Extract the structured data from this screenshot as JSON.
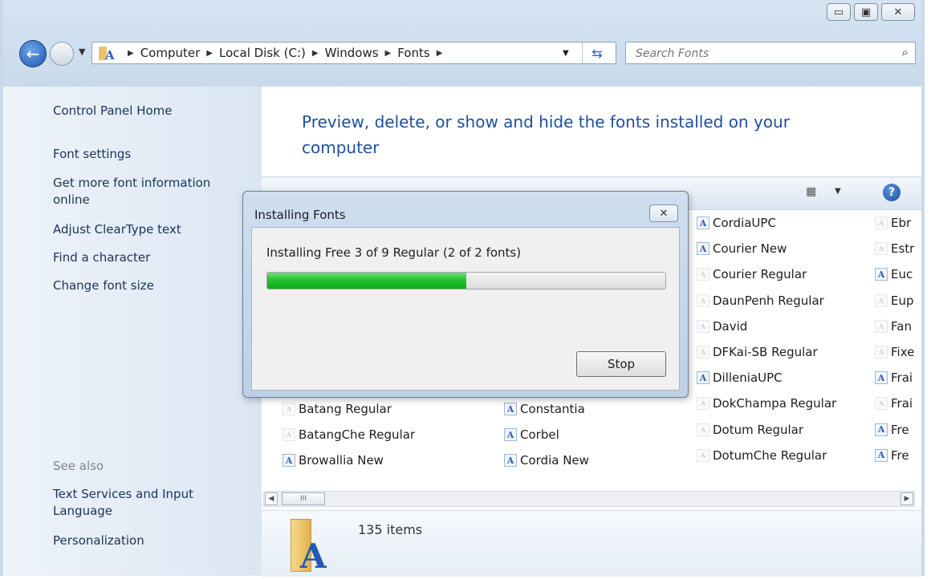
{
  "window": {
    "caption": {
      "minimize": "▭",
      "maximize": "▣",
      "close": "✕"
    }
  },
  "nav": {
    "back_glyph": "←",
    "breadcrumbs": [
      "Computer",
      "Local Disk (C:)",
      "Windows",
      "Fonts"
    ],
    "search_placeholder": "Search Fonts"
  },
  "sidebar": {
    "links": [
      "Control Panel Home",
      "Font settings",
      "Get more font information online",
      "Adjust ClearType text",
      "Find a character",
      "Change font size"
    ],
    "see_also_label": "See also",
    "see_also": [
      "Text Services and Input Language",
      "Personalization"
    ]
  },
  "content": {
    "heading": "Preview, delete, or show and hide the fonts installed on your computer",
    "fonts_col1": [
      {
        "name": "Batang Regular",
        "icon": "font-faded-icon"
      },
      {
        "name": "BatangChe Regular",
        "icon": "font-faded-icon"
      },
      {
        "name": "Browallia New",
        "icon": "font-icon"
      }
    ],
    "fonts_col2": [
      {
        "name": "Constantia",
        "icon": "font-icon"
      },
      {
        "name": "Corbel",
        "icon": "font-icon"
      },
      {
        "name": "Cordia New",
        "icon": "font-icon"
      }
    ],
    "fonts_col3": [
      {
        "name": "CordiaUPC",
        "icon": "font-icon"
      },
      {
        "name": "Courier New",
        "icon": "font-icon"
      },
      {
        "name": "Courier Regular",
        "icon": "font-faded-icon"
      },
      {
        "name": "DaunPenh Regular",
        "icon": "font-faded-icon"
      },
      {
        "name": "David",
        "icon": "font-faded-icon"
      },
      {
        "name": "DFKai-SB Regular",
        "icon": "font-faded-icon"
      },
      {
        "name": "DilleniaUPC",
        "icon": "font-icon"
      },
      {
        "name": "DokChampa Regular",
        "icon": "font-faded-icon"
      },
      {
        "name": "Dotum Regular",
        "icon": "font-faded-icon"
      },
      {
        "name": "DotumChe Regular",
        "icon": "font-faded-icon"
      }
    ],
    "fonts_col4": [
      {
        "name": "Ebr",
        "icon": "font-faded-icon"
      },
      {
        "name": "Estr",
        "icon": "font-faded-icon"
      },
      {
        "name": "Euc",
        "icon": "font-icon"
      },
      {
        "name": "Eup",
        "icon": "font-faded-icon"
      },
      {
        "name": "Fan",
        "icon": "font-faded-icon"
      },
      {
        "name": "Fixe",
        "icon": "font-faded-icon"
      },
      {
        "name": "Frai",
        "icon": "font-icon"
      },
      {
        "name": "Frai",
        "icon": "font-faded-icon"
      },
      {
        "name": "Fre",
        "icon": "font-icon"
      },
      {
        "name": "Fre",
        "icon": "font-icon"
      }
    ],
    "item_count": "135 items",
    "scroll_thumb": "III"
  },
  "dialog": {
    "title": "Installing Fonts",
    "status": "Installing Free 3 of 9 Regular (2 of 2 fonts)",
    "progress_fraction": 0.5,
    "stop_label": "Stop"
  },
  "colors": {
    "heading": "#1e4f9c",
    "link": "#1a3358",
    "progress_green": "#24c231"
  }
}
